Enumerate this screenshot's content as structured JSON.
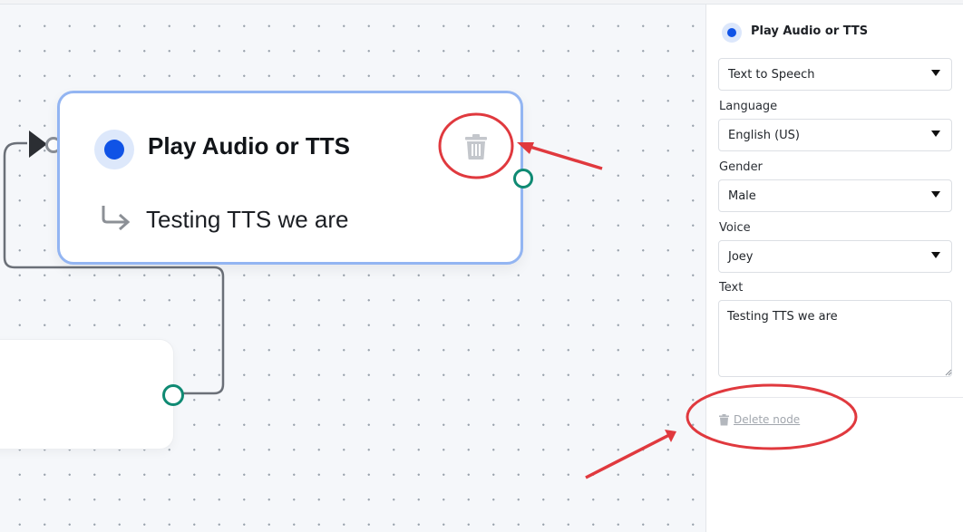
{
  "node": {
    "title": "Play Audio or TTS",
    "preview_text": "Testing TTS we are"
  },
  "panel": {
    "title": "Play Audio or TTS",
    "mode_value": "Text to Speech",
    "language_label": "Language",
    "language_value": "English (US)",
    "gender_label": "Gender",
    "gender_value": "Male",
    "voice_label": "Voice",
    "voice_value": "Joey",
    "text_label": "Text",
    "text_value": "Testing TTS we are",
    "delete_label": "Delete node"
  },
  "icons": {
    "node_delete": "trash-icon",
    "panel_delete": "trash-icon",
    "reply": "reply-arrow-icon",
    "entry_handle": "play-triangle-icon"
  },
  "colors": {
    "accent_blue": "#1053e6",
    "node_border": "#93b5f2",
    "port_green": "#0f8a73",
    "annotation_red": "#e0393e"
  }
}
